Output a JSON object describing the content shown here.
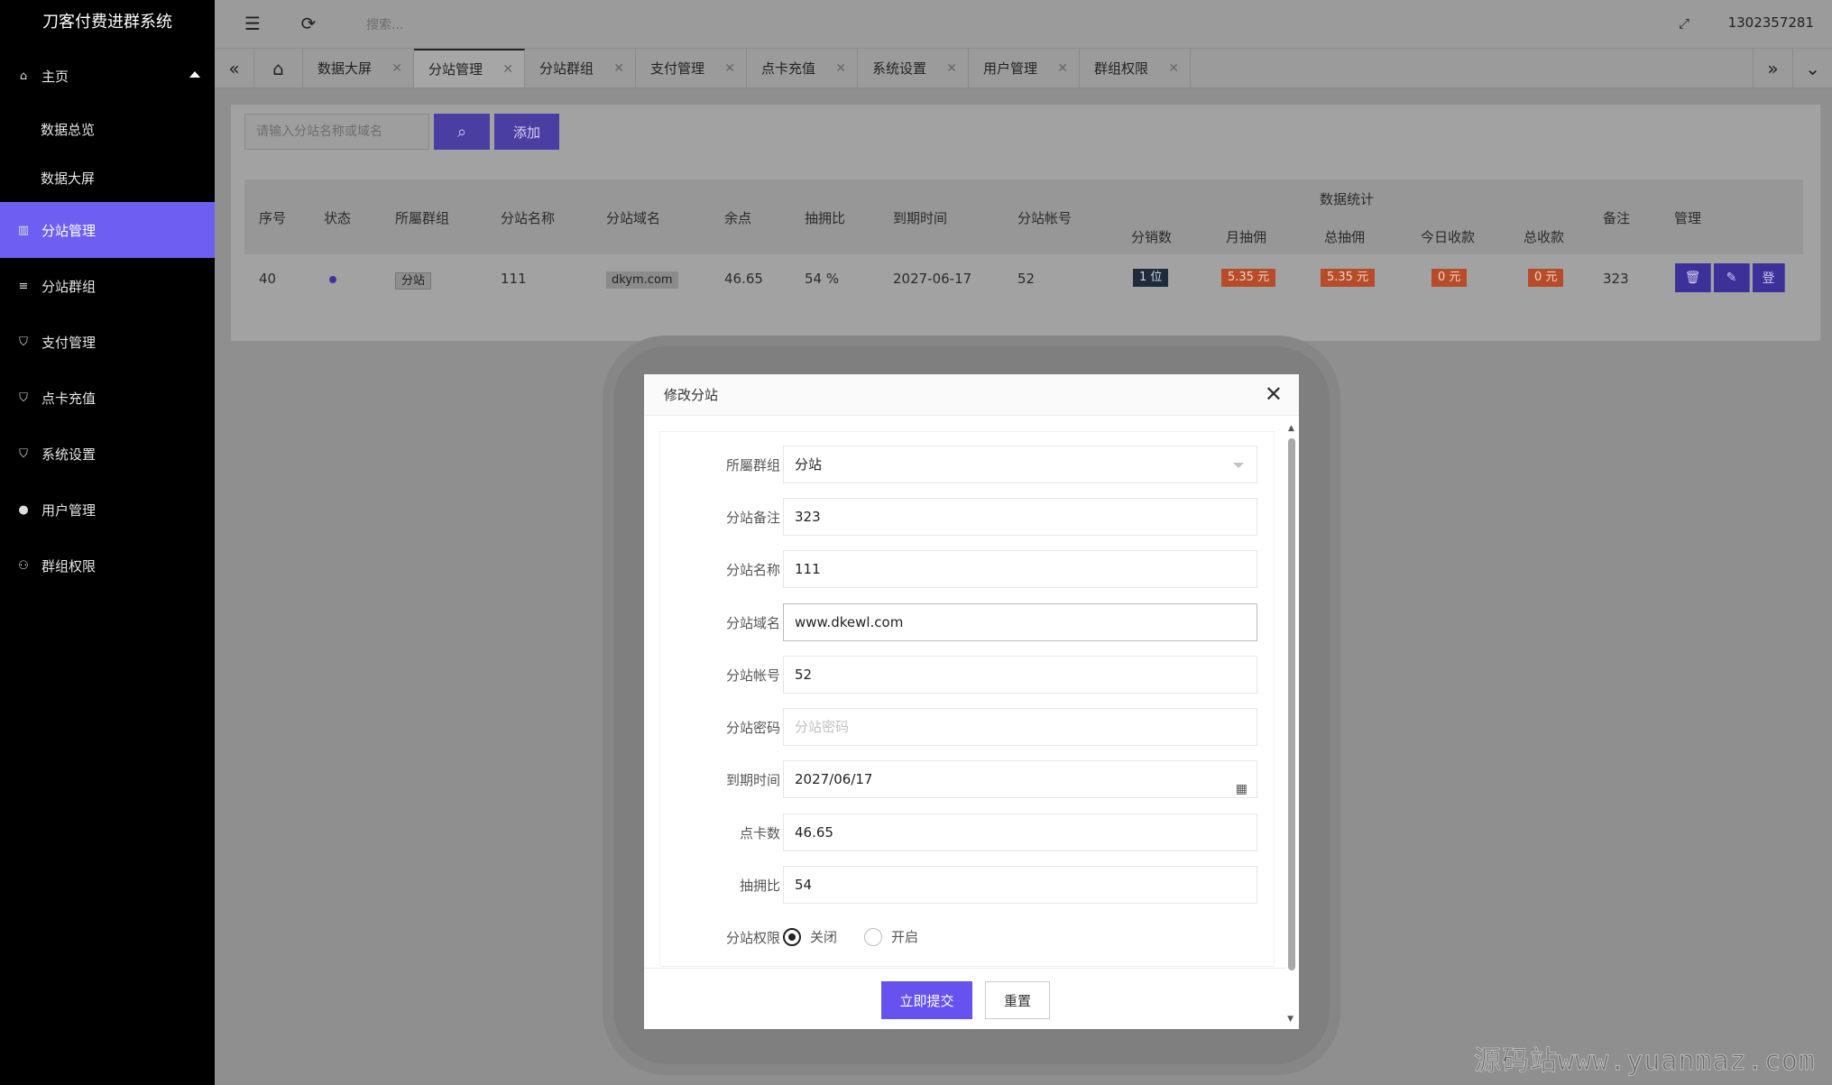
{
  "app": {
    "title": "刀客付费进群系统",
    "user": "1302357281"
  },
  "topbar": {
    "search_placeholder": "搜索..."
  },
  "sidebar": {
    "home": "主页",
    "home_sub": [
      "数据总览",
      "数据大屏"
    ],
    "items": [
      "分站管理",
      "分站群组",
      "支付管理",
      "点卡充值",
      "系统设置",
      "用户管理",
      "群组权限"
    ],
    "active": "分站管理"
  },
  "tabs": [
    "数据大屏",
    "分站管理",
    "分站群组",
    "支付管理",
    "点卡充值",
    "系统设置",
    "用户管理",
    "群组权限"
  ],
  "active_tab": "分站管理",
  "toolbar": {
    "search_placeholder": "请输入分站名称或域名",
    "add_label": "添加"
  },
  "table": {
    "group_header": "数据统计",
    "headers": {
      "index": "序号",
      "status": "状态",
      "group": "所屬群组",
      "name": "分站名称",
      "domain": "分站域名",
      "balance": "余点",
      "ratio": "抽拥比",
      "expire": "到期时间",
      "account": "分站帐号",
      "sales": "分销数",
      "month_comm": "月抽佣",
      "total_comm": "总抽佣",
      "today_income": "今日收款",
      "total_income": "总收款",
      "remark": "备注",
      "manage": "管理"
    },
    "row": {
      "index": "40",
      "group": "分站",
      "name": "111",
      "domain": "dkym.com",
      "balance": "46.65",
      "ratio": "54 %",
      "expire": "2027-06-17",
      "account": "52",
      "sales": "1 位",
      "month_comm": "5.35 元",
      "total_comm": "5.35 元",
      "today_income": "0 元",
      "total_income": "0 元",
      "remark": "323",
      "action_login": "登"
    }
  },
  "modal": {
    "title": "修改分站",
    "fields": {
      "group": {
        "label": "所屬群组",
        "value": "分站"
      },
      "remark": {
        "label": "分站备注",
        "value": "323"
      },
      "name": {
        "label": "分站名称",
        "value": "111"
      },
      "domain": {
        "label": "分站域名",
        "value": "www.dkewl.com"
      },
      "account": {
        "label": "分站帐号",
        "value": "52"
      },
      "password": {
        "label": "分站密码",
        "placeholder": "分站密码"
      },
      "expire": {
        "label": "到期时间",
        "value": "2027/06/17"
      },
      "points": {
        "label": "点卡数",
        "value": "46.65"
      },
      "ratio": {
        "label": "抽拥比",
        "value": "54"
      },
      "permission": {
        "label": "分站权限",
        "options": [
          "关闭",
          "开启"
        ],
        "selected": "关闭"
      }
    },
    "submit": "立即提交",
    "reset": "重置"
  },
  "watermark": "源码站www.yuanmaz.com",
  "colors": {
    "accent": "#6d5ff1",
    "sidebar_bg": "#000000",
    "badge_red": "#e05a2b",
    "badge_dark": "#2f3e55"
  }
}
